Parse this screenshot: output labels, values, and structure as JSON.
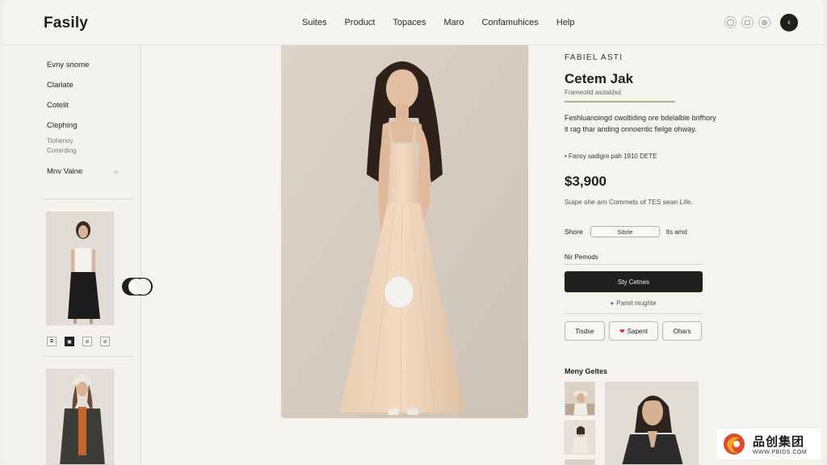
{
  "header": {
    "logo": "Fasily",
    "nav": [
      "Suites",
      "Product",
      "Topaces",
      "Maro",
      "Confamuhices",
      "Help"
    ],
    "icons": [
      "shield-icon",
      "bag-icon",
      "user-icon"
    ],
    "back_icon": "back-arrow-icon"
  },
  "sidebar": {
    "items": [
      "Evny snome",
      "Clariate",
      "Cotelit",
      "Clephing"
    ],
    "sub_lines": [
      "Tiohenoy",
      "Consrding"
    ],
    "more": "Mnv Vaine",
    "swatches": [
      "⧉",
      "▣",
      "⊘",
      "⊘"
    ]
  },
  "product": {
    "brand": "FABIEL ASTI",
    "title": "Cetem Jak",
    "subtitle": "Frameoild asdaldsd",
    "description": "Feshluanoingd cwoltiding ore bdelalble brifhory it rag thar anding onnoentic fielge ohway.",
    "meta": "• Fansy sadigre pah 1910 DETE",
    "price": "$3,900",
    "note": "Suipe she arn Commets of TES sean Life.",
    "size_label": "Shore",
    "size_value": "Sibrle",
    "size_note": "lts amd",
    "pref_label": "Nir Pemods",
    "buy_label": "Sty Cetnes",
    "find_label": "Pamit mughte",
    "actions": [
      "Tisdse",
      "Sapent",
      "Ohars"
    ]
  },
  "more": {
    "title": "Meny Geltes"
  },
  "watermark": {
    "brand": "品创集团",
    "url": "WWW.PBIDS.COM"
  },
  "colors": {
    "accent_dark": "#1f1f1f",
    "underline": "#a7b295",
    "heart": "#c0392b"
  }
}
